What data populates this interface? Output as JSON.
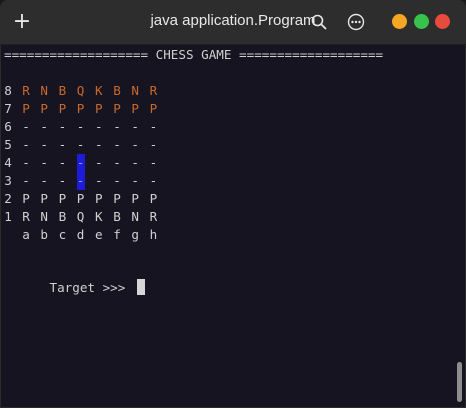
{
  "window": {
    "title": "java application.Program",
    "colors": {
      "minimize": "#f5a623",
      "maximize": "#36c24b",
      "close": "#e64b3c",
      "highlight": "#1d1bd8",
      "black_piece": "#c8692c"
    }
  },
  "toolbar": {
    "new_tab_icon": "+",
    "search_icon": "search-icon",
    "menu_icon": "kebab-menu-icon"
  },
  "terminal": {
    "header": "=================== CHESS GAME ===================",
    "board": [
      {
        "rank": "8",
        "cells": [
          "R",
          "N",
          "B",
          "Q",
          "K",
          "B",
          "N",
          "R"
        ],
        "color": "orange"
      },
      {
        "rank": "7",
        "cells": [
          "P",
          "P",
          "P",
          "P",
          "P",
          "P",
          "P",
          "P"
        ],
        "color": "orange"
      },
      {
        "rank": "6",
        "cells": [
          "-",
          "-",
          "-",
          "-",
          "-",
          "-",
          "-",
          "-"
        ],
        "color": "white"
      },
      {
        "rank": "5",
        "cells": [
          "-",
          "-",
          "-",
          "-",
          "-",
          "-",
          "-",
          "-"
        ],
        "color": "white"
      },
      {
        "rank": "4",
        "cells": [
          "-",
          "-",
          "-",
          "-",
          "-",
          "-",
          "-",
          "-"
        ],
        "color": "white"
      },
      {
        "rank": "3",
        "cells": [
          "-",
          "-",
          "-",
          "-",
          "-",
          "-",
          "-",
          "-"
        ],
        "color": "white"
      },
      {
        "rank": "2",
        "cells": [
          "P",
          "P",
          "P",
          "P",
          "P",
          "P",
          "P",
          "P"
        ],
        "color": "white"
      },
      {
        "rank": "1",
        "cells": [
          "R",
          "N",
          "B",
          "Q",
          "K",
          "B",
          "N",
          "R"
        ],
        "color": "white"
      }
    ],
    "highlighted_squares": [
      "d4",
      "d3"
    ],
    "files": [
      "a",
      "b",
      "c",
      "d",
      "e",
      "f",
      "g",
      "h"
    ],
    "prompt": "Target >>> "
  }
}
